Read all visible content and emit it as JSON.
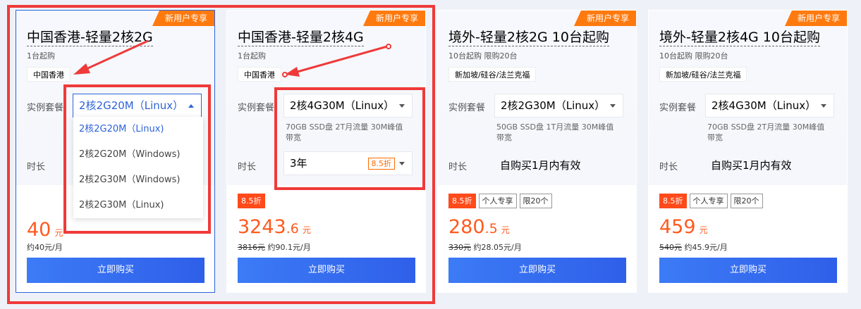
{
  "cards": [
    {
      "badge": "新用户专享",
      "title": "中国香港-轻量2核2G",
      "sub": "1台起购",
      "region": "中国香港",
      "plan_label": "实例套餐",
      "plan_value": "2核2G20M（Linux）",
      "plan_options": [
        "2核2G20M（Linux)",
        "2核2G20M（Windows)",
        "2核2G30M（Windows)",
        "2核2G30M（Linux)"
      ],
      "duration_label": "时长",
      "price_int": "40",
      "price_unit": "元",
      "per_month": "约40元/月",
      "buy_label": "立即购买"
    },
    {
      "badge": "新用户专享",
      "title": "中国香港-轻量2核4G",
      "sub": "1台起购",
      "region": "中国香港",
      "plan_label": "实例套餐",
      "plan_value": "2核4G30M（Linux）",
      "spec": "70GB SSD盘 2T月流量 30M峰值带宽",
      "duration_label": "时长",
      "duration_value": "3年",
      "duration_discount": "8.5折",
      "discount_tag": "8.5折",
      "price_int": "3243",
      "price_dec": ".6",
      "price_unit": "元",
      "orig_price": "3816元",
      "per_month": "约90.1元/月",
      "buy_label": "立即购买"
    },
    {
      "badge": "新用户专享",
      "title": "境外-轻量2核2G 10台起购",
      "sub": "10台起购 限购20台",
      "region": "新加坡/硅谷/法兰克福",
      "plan_label": "实例套餐",
      "plan_value": "2核2G30M（Linux）",
      "spec": "50GB SSD盘 1T月流量 30M峰值带宽",
      "duration_label": "时长",
      "duration_value": "自购买1月内有效",
      "discount_tag": "8.5折",
      "tag_personal": "个人专享",
      "tag_limit": "限20个",
      "price_int": "280",
      "price_dec": ".5",
      "price_unit": "元",
      "orig_price": "330元",
      "per_month": "约28.05元/月",
      "buy_label": "立即购买"
    },
    {
      "badge": "新用户专享",
      "title": "境外-轻量2核4G 10台起购",
      "sub": "10台起购 限购20台",
      "region": "新加坡/硅谷/法兰克福",
      "plan_label": "实例套餐",
      "plan_value": "2核4G30M（Linux）",
      "spec": "70GB SSD盘 2T月流量 30M峰值带宽",
      "duration_label": "时长",
      "duration_value": "自购买1月内有效",
      "discount_tag": "8.5折",
      "tag_personal": "个人专享",
      "tag_limit": "限20个",
      "price_int": "459",
      "price_unit": "元",
      "orig_price": "540元",
      "per_month": "约45.9元/月",
      "buy_label": "立即购买"
    }
  ],
  "colors": {
    "accent": "#2d63d8",
    "badge": "#ff7a0e",
    "price": "#ff5a1f",
    "annotation": "#ef3a3a"
  }
}
